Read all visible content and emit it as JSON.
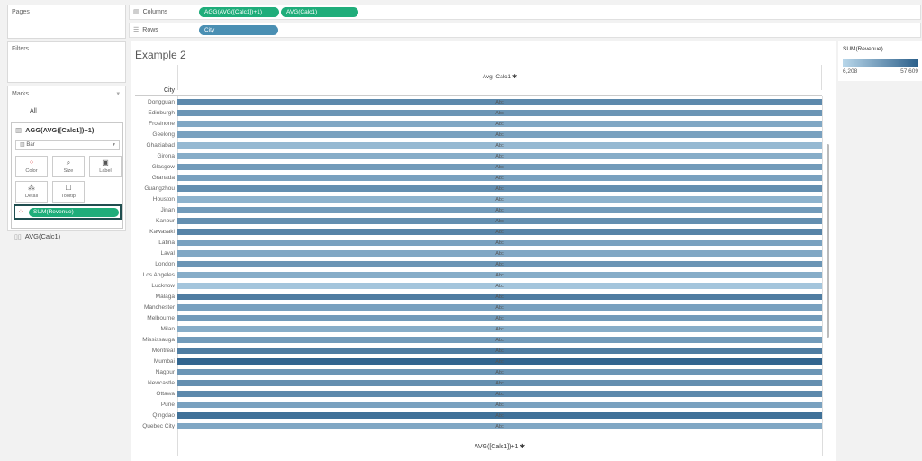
{
  "pages": {
    "title": "Pages"
  },
  "filters": {
    "title": "Filters"
  },
  "marks": {
    "title": "Marks",
    "all_label": "All",
    "card_title": "AGG(AVG([Calc1])+1)",
    "mark_type": "Bar",
    "buttons": {
      "color": "Color",
      "size": "Size",
      "label": "Label",
      "detail": "Detail",
      "tooltip": "Tooltip"
    },
    "color_pill": "SUM(Revenue)",
    "second_card": "AVG(Calc1)"
  },
  "shelves": {
    "columns_label": "Columns",
    "columns_pills": [
      "AGG(AVG([Calc1])+1)",
      "AVG(Calc1)"
    ],
    "rows_label": "Rows",
    "rows_pills": [
      "City"
    ]
  },
  "view": {
    "sheet_title": "Example 2",
    "column_header": "Avg. Calc1 ✱",
    "row_header": "City",
    "bottom_axis": "AVG([Calc1])+1 ✱",
    "cell_text": "Abc"
  },
  "legend": {
    "title": "SUM(Revenue)",
    "min": "6,208",
    "max": "57,609",
    "color_low": "#b9d7ea",
    "color_high": "#2b5f8a"
  },
  "chart_data": {
    "type": "bar",
    "categories": [
      "Dongguan",
      "Edinburgh",
      "Frosinone",
      "Geelong",
      "Ghaziabad",
      "Girona",
      "Glasgow",
      "Granada",
      "Guangzhou",
      "Houston",
      "Jinan",
      "Kanpur",
      "Kawasaki",
      "Latina",
      "Laval",
      "London",
      "Los Angeles",
      "Lucknow",
      "Malaga",
      "Manchester",
      "Melbourne",
      "Milan",
      "Mississauga",
      "Montreal",
      "Mumbai",
      "Nagpur",
      "Newcastle",
      "Ottawa",
      "Pune",
      "Qingdao",
      "Quebec City"
    ],
    "shade": [
      0.65,
      0.55,
      0.4,
      0.45,
      0.25,
      0.35,
      0.5,
      0.45,
      0.6,
      0.3,
      0.5,
      0.6,
      0.7,
      0.45,
      0.4,
      0.55,
      0.35,
      0.15,
      0.75,
      0.45,
      0.5,
      0.35,
      0.5,
      0.75,
      0.95,
      0.55,
      0.6,
      0.65,
      0.45,
      0.85,
      0.4
    ]
  }
}
